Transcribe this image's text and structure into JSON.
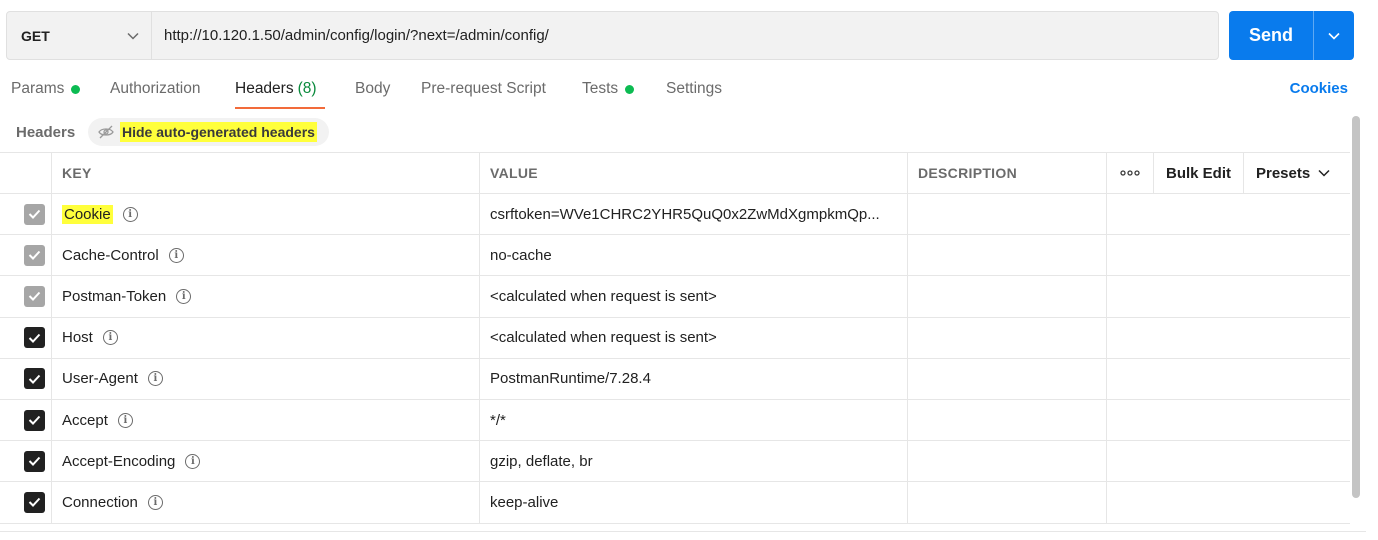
{
  "request": {
    "method": "GET",
    "url": "http://10.120.1.50/admin/config/login/?next=/admin/config/",
    "send_label": "Send"
  },
  "tabs": [
    {
      "label": "Params",
      "count": "",
      "dot": true,
      "active": false
    },
    {
      "label": "Authorization",
      "count": "",
      "dot": false,
      "active": false
    },
    {
      "label": "Headers",
      "count": "(8)",
      "dot": false,
      "active": true
    },
    {
      "label": "Body",
      "count": "",
      "dot": false,
      "active": false
    },
    {
      "label": "Pre-request Script",
      "count": "",
      "dot": false,
      "active": false
    },
    {
      "label": "Tests",
      "count": "",
      "dot": true,
      "active": false
    },
    {
      "label": "Settings",
      "count": "",
      "dot": false,
      "active": false
    }
  ],
  "cookies_label": "Cookies",
  "headers_section": {
    "title": "Headers",
    "hide_toggle_label": "Hide auto-generated headers"
  },
  "table": {
    "columns": {
      "key": "KEY",
      "value": "VALUE",
      "description": "DESCRIPTION"
    },
    "more_label": "ooo",
    "bulk_edit_label": "Bulk Edit",
    "presets_label": "Presets",
    "rows": [
      {
        "key": "Cookie",
        "value": "csrftoken=WVe1CHRC2YHR5QuQ0x2ZwMdXgmpkmQp...",
        "auto": true,
        "checked": true
      },
      {
        "key": "Cache-Control",
        "value": "no-cache",
        "auto": true,
        "checked": true
      },
      {
        "key": "Postman-Token",
        "value": "<calculated when request is sent>",
        "auto": true,
        "checked": true
      },
      {
        "key": "Host",
        "value": "<calculated when request is sent>",
        "auto": false,
        "checked": true
      },
      {
        "key": "User-Agent",
        "value": "PostmanRuntime/7.28.4",
        "auto": false,
        "checked": true
      },
      {
        "key": "Accept",
        "value": "*/*",
        "auto": false,
        "checked": true
      },
      {
        "key": "Accept-Encoding",
        "value": "gzip, deflate, br",
        "auto": false,
        "checked": true
      },
      {
        "key": "Connection",
        "value": "keep-alive",
        "auto": false,
        "checked": true
      }
    ]
  },
  "colors": {
    "accent": "#097bed",
    "active_tab_underline": "#f26b3a",
    "status_dot": "#0cbb52",
    "highlight": "#ffff3b"
  }
}
